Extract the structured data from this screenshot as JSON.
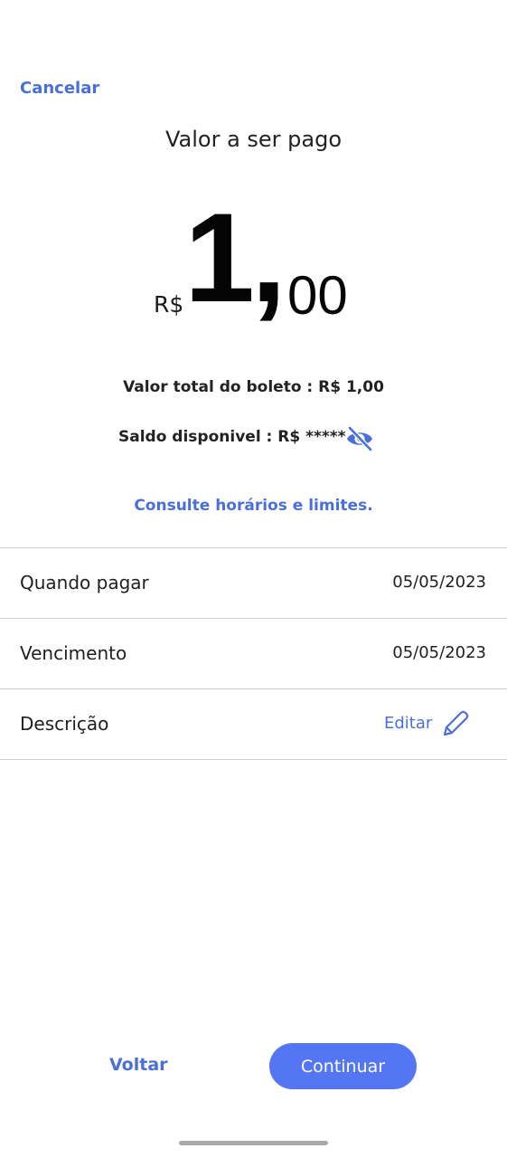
{
  "header": {
    "cancel_label": "Cancelar",
    "title": "Valor a ser pago"
  },
  "amount": {
    "currency": "R$",
    "integer": "1",
    "separator": ",",
    "cents": "00"
  },
  "summary": {
    "total_text": "Valor total do boleto : R$ 1,00",
    "balance_text": "Saldo disponivel : R$ *****",
    "balance_visibility_icon": "eye-off-icon",
    "limits_link": "Consulte horários e limites."
  },
  "details": {
    "when_label": "Quando pagar",
    "when_value": "05/05/2023",
    "due_label": "Vencimento",
    "due_value": "05/05/2023",
    "description_label": "Descrição",
    "edit_label": "Editar",
    "edit_icon": "pencil-icon"
  },
  "footer": {
    "back_label": "Voltar",
    "continue_label": "Continuar"
  },
  "colors": {
    "accent": "#4a6fd8",
    "primary_button": "#5476f4",
    "divider": "#cfcfcf"
  }
}
